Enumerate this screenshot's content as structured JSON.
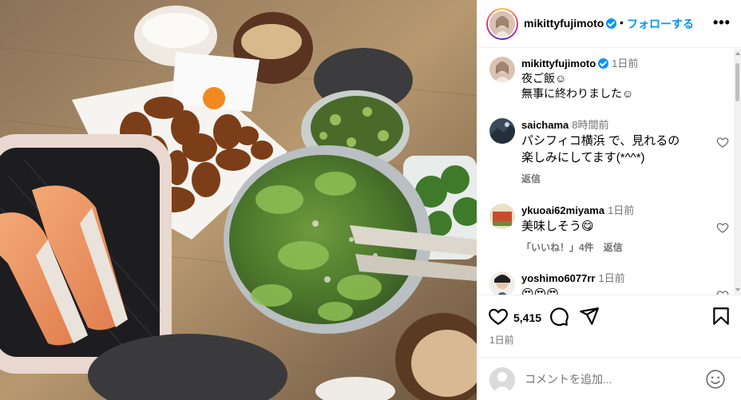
{
  "post": {
    "author": "mikittyfujimoto",
    "follow_label": "フォローする",
    "more_label": "•••",
    "caption": {
      "time": "1日前",
      "lines": [
        "夜ご飯☺︎",
        "無事に終わりました☺︎"
      ]
    }
  },
  "comments": [
    {
      "user": "saichama",
      "time": "8時間前",
      "lines": [
        "パシフィコ横浜 で、見れるの",
        "楽しみにしてます(*^^*)"
      ],
      "reply_label": "返信"
    },
    {
      "user": "ykuoai62miyama",
      "time": "1日前",
      "lines": [
        "美味しそう😋"
      ],
      "likes_label": "「いいね！」4件",
      "reply_label": "返信"
    },
    {
      "user": "yoshimo6077rr",
      "time": "1日前",
      "lines": [
        "😍😍😍"
      ]
    }
  ],
  "actions": {
    "like_count": "5,415",
    "date": "1日前"
  },
  "add_comment": {
    "placeholder": "コメントを追加..."
  },
  "colors": {
    "link_blue": "#0095f6",
    "verified_blue": "#0095f6",
    "secondary_text": "#737373"
  }
}
